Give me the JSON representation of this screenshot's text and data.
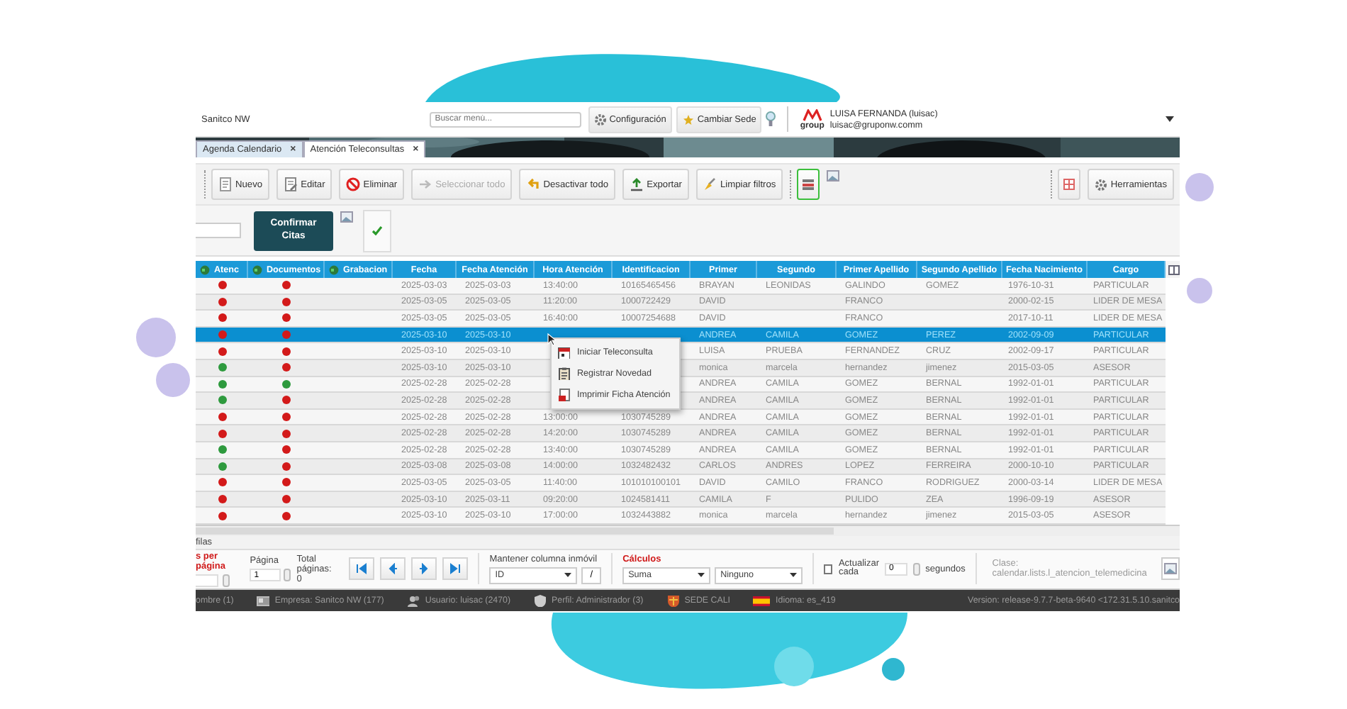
{
  "app": {
    "company": "Sanitco NW",
    "search": {
      "placeholder": "Buscar menú..."
    },
    "header_buttons": [
      "Configuración",
      "Cambiar Sede"
    ],
    "logo_text": "group",
    "user": {
      "name": "LUISA FERNANDA (luisac)",
      "email": "luisac@gruponw.comm"
    }
  },
  "tabs": [
    {
      "label": "Agenda Calendario",
      "close": "×",
      "selected": false
    },
    {
      "label": "Atención Teleconsultas",
      "close": "×",
      "selected": true
    }
  ],
  "toolbar": {
    "buttons": [
      {
        "label": "Nuevo",
        "kind": "doc",
        "disabled": false
      },
      {
        "label": "Editar",
        "kind": "edit",
        "disabled": false
      },
      {
        "label": "Eliminar",
        "kind": "delete",
        "disabled": false
      },
      {
        "label": "Seleccionar todo",
        "kind": "select",
        "disabled": true
      },
      {
        "label": "Desactivar todo",
        "kind": "undo",
        "disabled": false
      },
      {
        "label": "Exportar",
        "kind": "export",
        "disabled": false
      },
      {
        "label": "Limpiar filtros",
        "kind": "clear",
        "disabled": false
      }
    ],
    "view_toggle": {
      "selected": true
    },
    "tools_button": "Herramientas"
  },
  "filter_row": {
    "confirm_button": "Confirmar Citas"
  },
  "table": {
    "columns": [
      "Atenc",
      "Documentos",
      "Grabacion",
      "Fecha",
      "Fecha Atención",
      "Hora Atención",
      "Identificacion",
      "Primer",
      "Segundo",
      "Primer Apellido",
      "Segundo Apellido",
      "Fecha Nacimiento",
      "Cargo"
    ],
    "rows": [
      {
        "selected": false,
        "status": [
          {
            "color": "#d31a1a"
          },
          {
            "color": "#d31a1a"
          }
        ],
        "cells": [
          "",
          "",
          "",
          "2025-03-03",
          "2025-03-03",
          "13:40:00",
          "10165465456",
          "BRAYAN",
          "LEONIDAS",
          "GALINDO",
          "GOMEZ",
          "1976-10-31",
          "PARTICULAR"
        ]
      },
      {
        "selected": false,
        "status": [
          {
            "color": "#d31a1a"
          },
          {
            "color": "#d31a1a"
          }
        ],
        "cells": [
          "",
          "",
          "",
          "2025-03-05",
          "2025-03-05",
          "11:20:00",
          "1000722429",
          "DAVID",
          "",
          "FRANCO",
          "",
          "2000-02-15",
          "LIDER DE MESA"
        ]
      },
      {
        "selected": false,
        "status": [
          {
            "color": "#d31a1a"
          },
          {
            "color": "#d31a1a"
          }
        ],
        "cells": [
          "",
          "",
          "",
          "2025-03-05",
          "2025-03-05",
          "16:40:00",
          "10007254688",
          "DAVID",
          "",
          "FRANCO",
          "",
          "2017-10-11",
          "LIDER DE MESA"
        ]
      },
      {
        "selected": true,
        "status": [
          {
            "color": "#d31a1a"
          },
          {
            "color": "#d31a1a"
          }
        ],
        "cells": [
          "",
          "",
          "",
          "2025-03-10",
          "2025-03-10",
          "",
          "",
          "ANDREA",
          "CAMILA",
          "GOMEZ",
          "PEREZ",
          "2002-09-09",
          "PARTICULAR"
        ]
      },
      {
        "selected": false,
        "status": [
          {
            "color": "#d31a1a"
          },
          {
            "color": "#d31a1a"
          }
        ],
        "cells": [
          "",
          "",
          "",
          "2025-03-10",
          "2025-03-10",
          "",
          "",
          "LUISA",
          "PRUEBA",
          "FERNANDEZ",
          "CRUZ",
          "2002-09-17",
          "PARTICULAR"
        ]
      },
      {
        "selected": false,
        "status": [
          {
            "color": "#2e9a3e"
          },
          {
            "color": "#d31a1a"
          }
        ],
        "cells": [
          "",
          "",
          "",
          "2025-03-10",
          "2025-03-10",
          "",
          "",
          "monica",
          "marcela",
          "hernandez",
          "jimenez",
          "2015-03-05",
          "ASESOR"
        ]
      },
      {
        "selected": false,
        "status": [
          {
            "color": "#2e9a3e"
          },
          {
            "color": "#2e9a3e"
          }
        ],
        "cells": [
          "",
          "",
          "",
          "2025-02-28",
          "2025-02-28",
          "",
          "",
          "ANDREA",
          "CAMILA",
          "GOMEZ",
          "BERNAL",
          "1992-01-01",
          "PARTICULAR"
        ]
      },
      {
        "selected": false,
        "status": [
          {
            "color": "#2e9a3e"
          },
          {
            "color": "#d31a1a"
          }
        ],
        "cells": [
          "",
          "",
          "",
          "2025-02-28",
          "2025-02-28",
          "",
          "",
          "ANDREA",
          "CAMILA",
          "GOMEZ",
          "BERNAL",
          "1992-01-01",
          "PARTICULAR"
        ]
      },
      {
        "selected": false,
        "status": [
          {
            "color": "#d31a1a"
          },
          {
            "color": "#d31a1a"
          }
        ],
        "cells": [
          "",
          "",
          "",
          "2025-02-28",
          "2025-02-28",
          "13:00:00",
          "1030745289",
          "ANDREA",
          "CAMILA",
          "GOMEZ",
          "BERNAL",
          "1992-01-01",
          "PARTICULAR"
        ]
      },
      {
        "selected": false,
        "status": [
          {
            "color": "#d31a1a"
          },
          {
            "color": "#d31a1a"
          }
        ],
        "cells": [
          "",
          "",
          "",
          "2025-02-28",
          "2025-02-28",
          "14:20:00",
          "1030745289",
          "ANDREA",
          "CAMILA",
          "GOMEZ",
          "BERNAL",
          "1992-01-01",
          "PARTICULAR"
        ]
      },
      {
        "selected": false,
        "status": [
          {
            "color": "#2e9a3e"
          },
          {
            "color": "#d31a1a"
          }
        ],
        "cells": [
          "",
          "",
          "",
          "2025-02-28",
          "2025-02-28",
          "13:40:00",
          "1030745289",
          "ANDREA",
          "CAMILA",
          "GOMEZ",
          "BERNAL",
          "1992-01-01",
          "PARTICULAR"
        ]
      },
      {
        "selected": false,
        "status": [
          {
            "color": "#2e9a3e"
          },
          {
            "color": "#d31a1a"
          }
        ],
        "cells": [
          "",
          "",
          "",
          "2025-03-08",
          "2025-03-08",
          "14:00:00",
          "1032482432",
          "CARLOS",
          "ANDRES",
          "LOPEZ",
          "FERREIRA",
          "2000-10-10",
          "PARTICULAR"
        ]
      },
      {
        "selected": false,
        "status": [
          {
            "color": "#d31a1a"
          },
          {
            "color": "#d31a1a"
          }
        ],
        "cells": [
          "",
          "",
          "",
          "2025-03-05",
          "2025-03-05",
          "11:40:00",
          "101010100101",
          "DAVID",
          "CAMILO",
          "FRANCO",
          "RODRIGUEZ",
          "2000-03-14",
          "LIDER DE MESA"
        ]
      },
      {
        "selected": false,
        "status": [
          {
            "color": "#d31a1a"
          },
          {
            "color": "#d31a1a"
          }
        ],
        "cells": [
          "",
          "",
          "",
          "2025-03-10",
          "2025-03-11",
          "09:20:00",
          "1024581411",
          "CAMILA",
          "F",
          "PULIDO",
          "ZEA",
          "1996-09-19",
          "ASESOR"
        ]
      },
      {
        "selected": false,
        "status": [
          {
            "color": "#d31a1a"
          },
          {
            "color": "#d31a1a"
          }
        ],
        "cells": [
          "",
          "",
          "",
          "2025-03-10",
          "2025-03-10",
          "17:00:00",
          "1032443882",
          "monica",
          "marcela",
          "hernandez",
          "jimenez",
          "2015-03-05",
          "ASESOR"
        ]
      }
    ]
  },
  "context_menu": {
    "items": [
      {
        "label": "Iniciar Teleconsulta",
        "kind": "calendar"
      },
      {
        "label": "Registrar Novedad",
        "kind": "clipboard"
      },
      {
        "label": "Imprimir Ficha Atención",
        "kind": "print"
      }
    ]
  },
  "footer": {
    "rows_label": "filas",
    "page_size_label": "s per página",
    "page_label": "Página",
    "page_value": "1",
    "total_label": "Total páginas: 0",
    "freeze_label": "Mantener columna inmóvil",
    "freeze_value": "ID",
    "freeze_button": "/",
    "calc_label": "Cálculos",
    "calc_values": [
      "Suma",
      "Ninguno"
    ],
    "refresh": {
      "label": "Actualizar cada",
      "checked": false,
      "value": "0",
      "unit": "segundos"
    },
    "class_label": "Clase: calendar.lists.l_atencion_telemedicina"
  },
  "status_bar": [
    {
      "text": "ombre (1)",
      "kind": "none"
    },
    {
      "text": "Empresa: Sanitco NW (177)",
      "kind": "card"
    },
    {
      "text": "Usuario: luisac (2470)",
      "kind": "user"
    },
    {
      "text": "Perfil: Administrador (3)",
      "kind": "shield"
    },
    {
      "text": "SEDE CALI",
      "kind": "crest"
    },
    {
      "text": "Idioma: es_419",
      "kind": "flag"
    },
    {
      "text": "Version: release-9.7.7-beta-9640 <172.31.5.10.sanitco",
      "kind": "none"
    }
  ]
}
